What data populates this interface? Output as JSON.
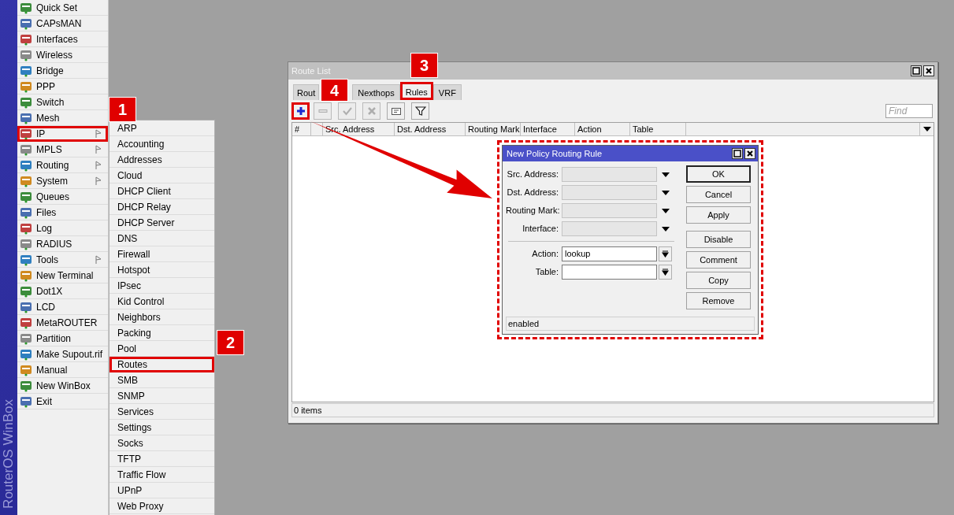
{
  "main_menu": {
    "brand": "RouterOS WinBox",
    "items": [
      {
        "label": "Quick Set",
        "has_submenu": false,
        "highlighted": false
      },
      {
        "label": "CAPsMAN",
        "has_submenu": false,
        "highlighted": false
      },
      {
        "label": "Interfaces",
        "has_submenu": false,
        "highlighted": false
      },
      {
        "label": "Wireless",
        "has_submenu": false,
        "highlighted": false
      },
      {
        "label": "Bridge",
        "has_submenu": false,
        "highlighted": false
      },
      {
        "label": "PPP",
        "has_submenu": false,
        "highlighted": false
      },
      {
        "label": "Switch",
        "has_submenu": false,
        "highlighted": false
      },
      {
        "label": "Mesh",
        "has_submenu": false,
        "highlighted": false
      },
      {
        "label": "IP",
        "has_submenu": true,
        "highlighted": true
      },
      {
        "label": "MPLS",
        "has_submenu": true,
        "highlighted": false
      },
      {
        "label": "Routing",
        "has_submenu": true,
        "highlighted": false
      },
      {
        "label": "System",
        "has_submenu": true,
        "highlighted": false
      },
      {
        "label": "Queues",
        "has_submenu": false,
        "highlighted": false
      },
      {
        "label": "Files",
        "has_submenu": false,
        "highlighted": false
      },
      {
        "label": "Log",
        "has_submenu": false,
        "highlighted": false
      },
      {
        "label": "RADIUS",
        "has_submenu": false,
        "highlighted": false
      },
      {
        "label": "Tools",
        "has_submenu": true,
        "highlighted": false
      },
      {
        "label": "New Terminal",
        "has_submenu": false,
        "highlighted": false
      },
      {
        "label": "Dot1X",
        "has_submenu": false,
        "highlighted": false
      },
      {
        "label": "LCD",
        "has_submenu": false,
        "highlighted": false
      },
      {
        "label": "MetaROUTER",
        "has_submenu": false,
        "highlighted": false
      },
      {
        "label": "Partition",
        "has_submenu": false,
        "highlighted": false
      },
      {
        "label": "Make Supout.rif",
        "has_submenu": false,
        "highlighted": false
      },
      {
        "label": "Manual",
        "has_submenu": false,
        "highlighted": false
      },
      {
        "label": "New WinBox",
        "has_submenu": false,
        "highlighted": false
      },
      {
        "label": "Exit",
        "has_submenu": false,
        "highlighted": false
      }
    ]
  },
  "submenu": {
    "items": [
      {
        "label": "ARP",
        "highlighted": false
      },
      {
        "label": "Accounting",
        "highlighted": false
      },
      {
        "label": "Addresses",
        "highlighted": false
      },
      {
        "label": "Cloud",
        "highlighted": false
      },
      {
        "label": "DHCP Client",
        "highlighted": false
      },
      {
        "label": "DHCP Relay",
        "highlighted": false
      },
      {
        "label": "DHCP Server",
        "highlighted": false
      },
      {
        "label": "DNS",
        "highlighted": false
      },
      {
        "label": "Firewall",
        "highlighted": false
      },
      {
        "label": "Hotspot",
        "highlighted": false
      },
      {
        "label": "IPsec",
        "highlighted": false
      },
      {
        "label": "Kid Control",
        "highlighted": false
      },
      {
        "label": "Neighbors",
        "highlighted": false
      },
      {
        "label": "Packing",
        "highlighted": false
      },
      {
        "label": "Pool",
        "highlighted": false
      },
      {
        "label": "Routes",
        "highlighted": true
      },
      {
        "label": "SMB",
        "highlighted": false
      },
      {
        "label": "SNMP",
        "highlighted": false
      },
      {
        "label": "Services",
        "highlighted": false
      },
      {
        "label": "Settings",
        "highlighted": false
      },
      {
        "label": "Socks",
        "highlighted": false
      },
      {
        "label": "TFTP",
        "highlighted": false
      },
      {
        "label": "Traffic Flow",
        "highlighted": false
      },
      {
        "label": "UPnP",
        "highlighted": false
      },
      {
        "label": "Web Proxy",
        "highlighted": false
      }
    ]
  },
  "route_list": {
    "title": "Route List",
    "tabs": [
      {
        "label": "Rout",
        "selected": false,
        "highlighted": false
      },
      {
        "label": "Nexthops",
        "selected": false,
        "highlighted": false
      },
      {
        "label": "Rules",
        "selected": true,
        "highlighted": true
      },
      {
        "label": "VRF",
        "selected": false,
        "highlighted": false
      }
    ],
    "toolbar": [
      {
        "kind": "add",
        "disabled": false,
        "highlighted": true
      },
      {
        "kind": "remove",
        "disabled": true
      },
      {
        "kind": "enable",
        "disabled": true
      },
      {
        "kind": "disable",
        "disabled": true
      },
      {
        "kind": "comment",
        "disabled": false
      },
      {
        "kind": "filter",
        "disabled": false
      }
    ],
    "find_placeholder": "Find",
    "columns": [
      "#",
      "Src. Address",
      "Dst. Address",
      "Routing Mark",
      "Interface",
      "Action",
      "Table"
    ],
    "status": "0 items"
  },
  "dialog": {
    "title": "New Policy Routing Rule",
    "highlighted": true,
    "fields": [
      {
        "label": "Src. Address:",
        "kind": "dropdown",
        "disabled": true
      },
      {
        "label": "Dst. Address:",
        "kind": "dropdown",
        "disabled": true
      },
      {
        "label": "Routing Mark:",
        "kind": "dropdown",
        "disabled": true
      },
      {
        "label": "Interface:",
        "kind": "dropdown",
        "disabled": true
      },
      {
        "label": "Action:",
        "kind": "combo",
        "disabled": false,
        "value": "lookup"
      },
      {
        "label": "Table:",
        "kind": "combo",
        "disabled": false
      }
    ],
    "button_groups": [
      [
        {
          "label": "OK",
          "default": true
        },
        {
          "label": "Cancel",
          "default": false
        },
        {
          "label": "Apply",
          "default": false
        }
      ],
      [
        {
          "label": "Disable",
          "default": false
        },
        {
          "label": "Comment",
          "default": false
        },
        {
          "label": "Copy",
          "default": false
        },
        {
          "label": "Remove",
          "default": false
        }
      ]
    ],
    "status": "enabled"
  },
  "step_badges": [
    "1",
    "2",
    "3",
    "4"
  ]
}
